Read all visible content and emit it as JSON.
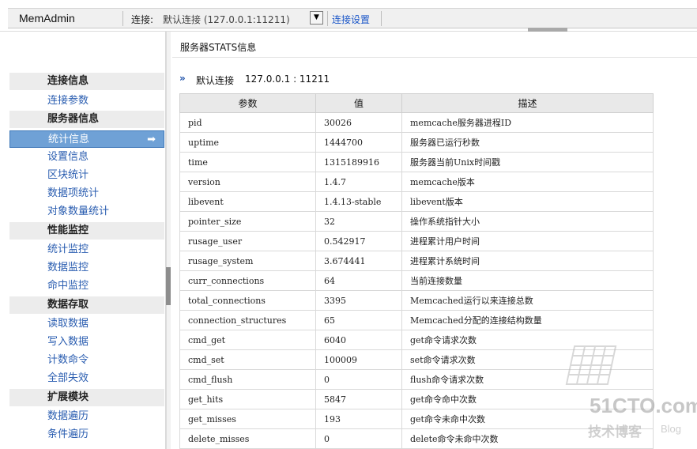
{
  "topbar": {
    "app_title": "MemAdmin",
    "connection_label": "连接:",
    "connection_value": "默认连接 (127.0.0.1:11211)",
    "connection_settings": "连接设置"
  },
  "sidebar": {
    "groups": [
      {
        "label": "连接信息",
        "items": [
          "连接参数"
        ]
      },
      {
        "label": "服务器信息",
        "items": [
          "统计信息",
          "设置信息",
          "区块统计",
          "数据项统计",
          "对象数量统计"
        ]
      },
      {
        "label": "性能监控",
        "items": [
          "统计监控",
          "数据监控",
          "命中监控"
        ]
      },
      {
        "label": "数据存取",
        "items": [
          "读取数据",
          "写入数据",
          "计数命令",
          "全部失效"
        ]
      },
      {
        "label": "扩展模块",
        "items": [
          "数据遍历",
          "条件遍历"
        ]
      }
    ],
    "active_item": "统计信息"
  },
  "main": {
    "title": "服务器STATS信息",
    "breadcrumb_icon": "»",
    "breadcrumb_label": "默认连接",
    "breadcrumb_address": "127.0.0.1 : 11211",
    "table": {
      "headers": [
        "参数",
        "值",
        "描述"
      ],
      "rows": [
        [
          "pid",
          "30026",
          "memcache服务器进程ID"
        ],
        [
          "uptime",
          "1444700",
          "服务器已运行秒数"
        ],
        [
          "time",
          "1315189916",
          "服务器当前Unix时间戳"
        ],
        [
          "version",
          "1.4.7",
          "memcache版本"
        ],
        [
          "libevent",
          "1.4.13-stable",
          "libevent版本"
        ],
        [
          "pointer_size",
          "32",
          "操作系统指针大小"
        ],
        [
          "rusage_user",
          "0.542917",
          "进程累计用户时间"
        ],
        [
          "rusage_system",
          "3.674441",
          "进程累计系统时间"
        ],
        [
          "curr_connections",
          "64",
          "当前连接数量"
        ],
        [
          "total_connections",
          "3395",
          "Memcached运行以来连接总数"
        ],
        [
          "connection_structures",
          "65",
          "Memcached分配的连接结构数量"
        ],
        [
          "cmd_get",
          "6040",
          "get命令请求次数"
        ],
        [
          "cmd_set",
          "100009",
          "set命令请求次数"
        ],
        [
          "cmd_flush",
          "0",
          "flush命令请求次数"
        ],
        [
          "get_hits",
          "5847",
          "get命令命中次数"
        ],
        [
          "get_misses",
          "193",
          "get命令未命中次数"
        ],
        [
          "delete_misses",
          "0",
          "delete命令未命中次数"
        ]
      ]
    }
  },
  "watermark": {
    "line1": "51CTO.com",
    "line2": "技术博客",
    "line3": "Blog"
  },
  "colors": {
    "link": "#2a5db0",
    "active_bg": "#6fa1d6",
    "group_bg": "#ececec",
    "header_bg": "#e9e9e9"
  }
}
